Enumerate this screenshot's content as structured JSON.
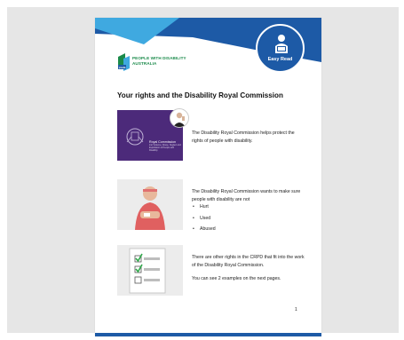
{
  "logo": {
    "brand_line1": "PEOPLE WITH DISABILITY",
    "brand_line2": "AUSTRALIA",
    "mark_text": "pwda"
  },
  "easy_read": {
    "label": "Easy Read"
  },
  "title": "Your rights and the Disability Royal Commission",
  "image_royal_commission": {
    "heading": "Royal Commission",
    "subheading": "into Violence, Abuse, Neglect and Exploitation of People with Disability"
  },
  "section1": {
    "text": "The Disability Royal Commission helps protect the rights of people with disability."
  },
  "section2": {
    "intro": "The Disability Royal Commission wants to make sure people with disability are not",
    "bullets": [
      "Hurt",
      "Used",
      "Abused"
    ]
  },
  "section3": {
    "text1": "There are other rights in the CRPD that fit into the work of the Disability Royal Commission.",
    "text2": "You can see 2 examples on the next pages."
  },
  "page_number": "1",
  "colors": {
    "brand_blue": "#1d5aa6",
    "light_blue": "#3fa9e0",
    "brand_green": "#1a8a4a",
    "commission_purple": "#4c2a7a"
  }
}
